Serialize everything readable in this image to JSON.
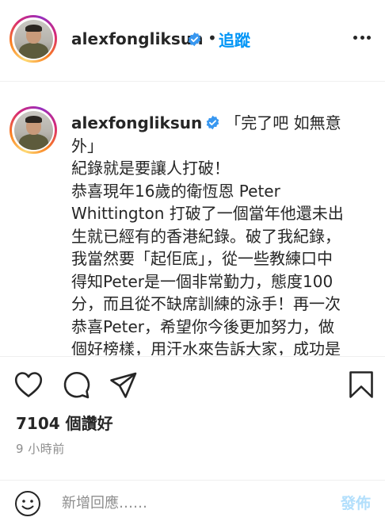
{
  "header": {
    "username": "alexfongliksun",
    "separator": "•",
    "follow_label": "追蹤",
    "more_icon": "more-horizontal-icon"
  },
  "caption": {
    "username": "alexfongliksun",
    "lines": [
      "「完了吧 如無意",
      "外」",
      "紀錄就是要讓人打破！",
      "恭喜現年16歲的衛恆恩 Peter",
      "Whittington 打破了一個當年他還未出",
      "生就已經有的香港紀錄。破了我紀錄，",
      "我當然要「起佢底」，從一些教練口中",
      "得知Peter是一個非常勤力，態度100",
      "分，而且從不缺席訓練的泳手！再一次",
      "恭喜Peter，希望你今後更加努力，做",
      "個好榜樣，用汗水來告訴大家，成功是"
    ]
  },
  "actions": {
    "icons": [
      "heart-icon",
      "comment-icon",
      "share-icon",
      "bookmark-icon"
    ]
  },
  "likes_text": "7104 個讚好",
  "timestamp": "9 小時前",
  "comment": {
    "placeholder": "新增回應……",
    "post_label": "發佈"
  },
  "colors": {
    "accent": "#0095f6",
    "verified": "#3897f0",
    "post_disabled": "#b2dffc",
    "text": "#262626",
    "muted": "#8e8e8e"
  }
}
